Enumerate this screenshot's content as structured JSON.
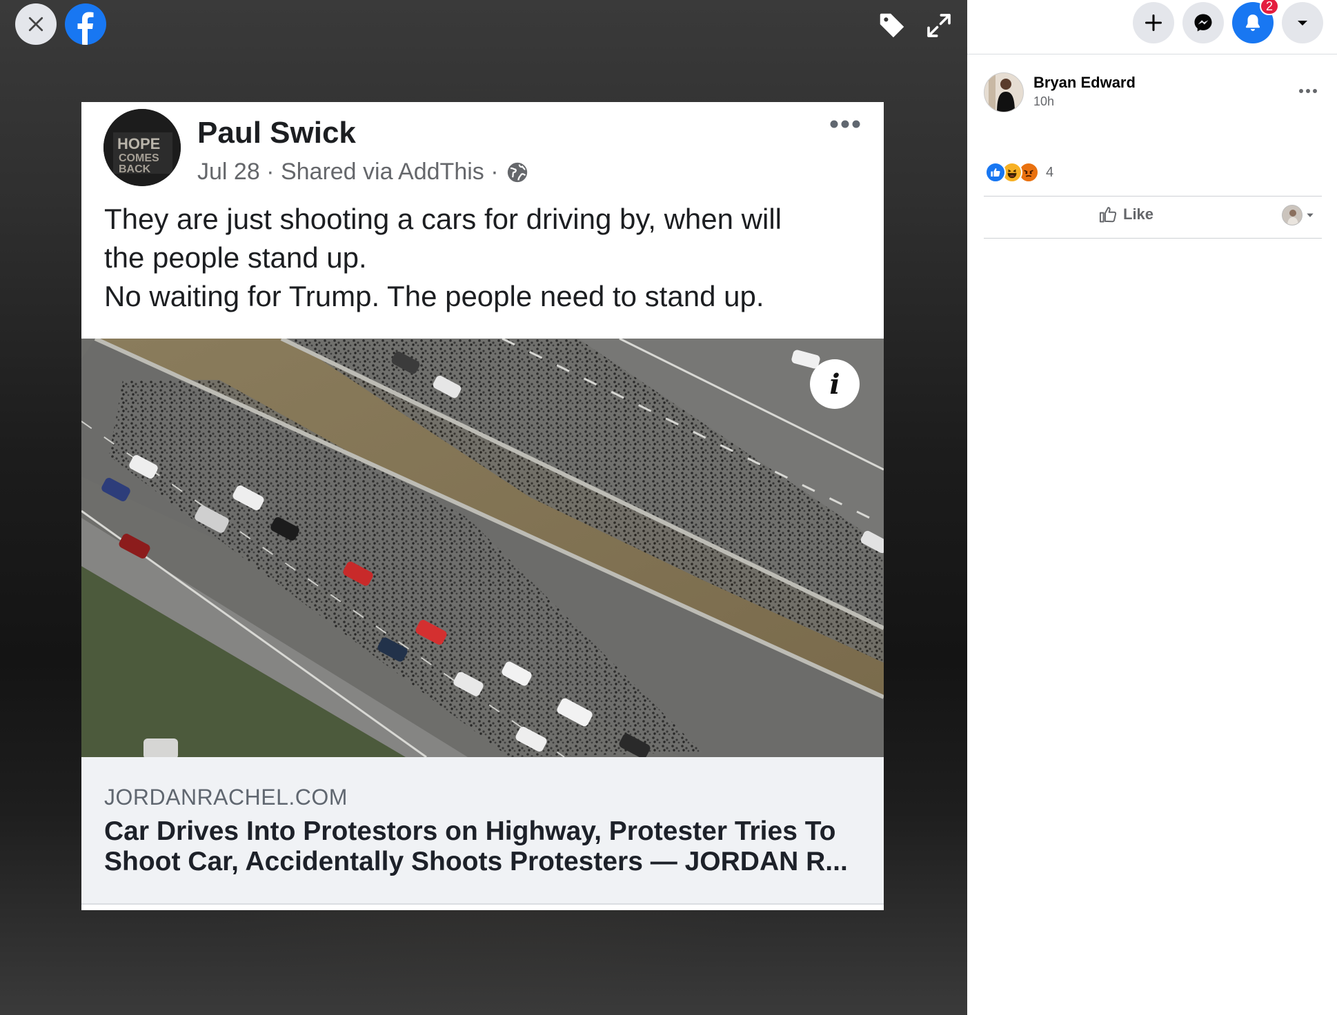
{
  "viewer": {
    "close_icon": "close-icon",
    "logo_icon": "facebook-logo",
    "tag_icon": "tag-icon",
    "expand_icon": "expand-icon"
  },
  "shared_post": {
    "author": "Paul Swick",
    "meta": "Jul 28 · Shared via AddThis ·",
    "avatar_text": [
      "HOPE",
      "COMES",
      "BACK"
    ],
    "text_lines": [
      "They are just shooting a cars for driving by, when will",
      "the people stand up.",
      "No waiting for Trump. The people need to stand up."
    ],
    "info_label": "i",
    "link": {
      "domain": "JORDANRACHEL.COM",
      "title": "Car Drives Into Protestors on Highway, Protester Tries To Shoot Car, Accidentally Shoots Protesters — JORDAN R..."
    }
  },
  "nav": {
    "notification_count": "2"
  },
  "side_panel": {
    "poster_name": "Bryan Edward",
    "poster_time": "10h",
    "reaction_count": "4",
    "like_label": "Like"
  },
  "colors": {
    "brand": "#1877f2",
    "badge": "#e41e3f"
  }
}
